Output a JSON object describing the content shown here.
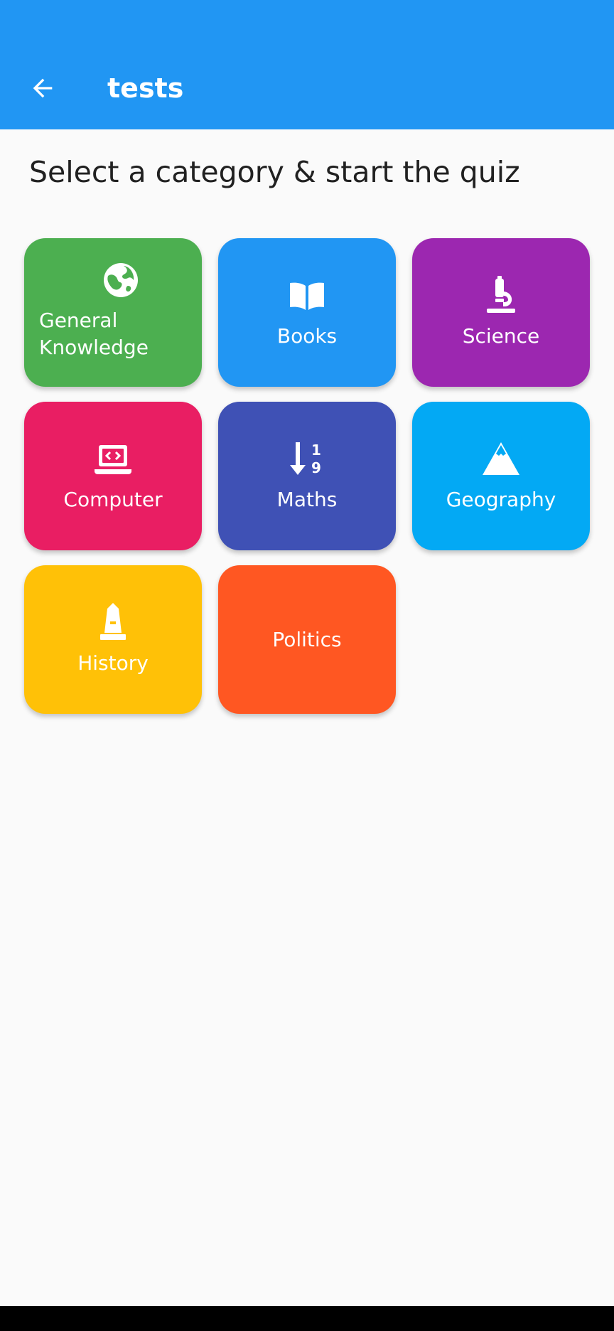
{
  "app_bar": {
    "title": "tests",
    "background": "#2196f3",
    "back_icon": "arrow-left-icon"
  },
  "heading": "Select a category & start the quiz",
  "categories": [
    {
      "label": "General Knowledge",
      "color": "#4caf50",
      "icon": "globe-icon"
    },
    {
      "label": "Books",
      "color": "#2196f3",
      "icon": "book-open-icon"
    },
    {
      "label": "Science",
      "color": "#9c27b0",
      "icon": "microscope-icon"
    },
    {
      "label": "Computer",
      "color": "#e91e63",
      "icon": "laptop-code-icon"
    },
    {
      "label": "Maths",
      "color": "#3f51b5",
      "icon": "sort-numeric-down-icon"
    },
    {
      "label": "Geography",
      "color": "#03a9f4",
      "icon": "mountain-icon"
    },
    {
      "label": "History",
      "color": "#ffc107",
      "icon": "monument-icon"
    },
    {
      "label": "Politics",
      "color": "#ff5722",
      "icon": ""
    }
  ]
}
